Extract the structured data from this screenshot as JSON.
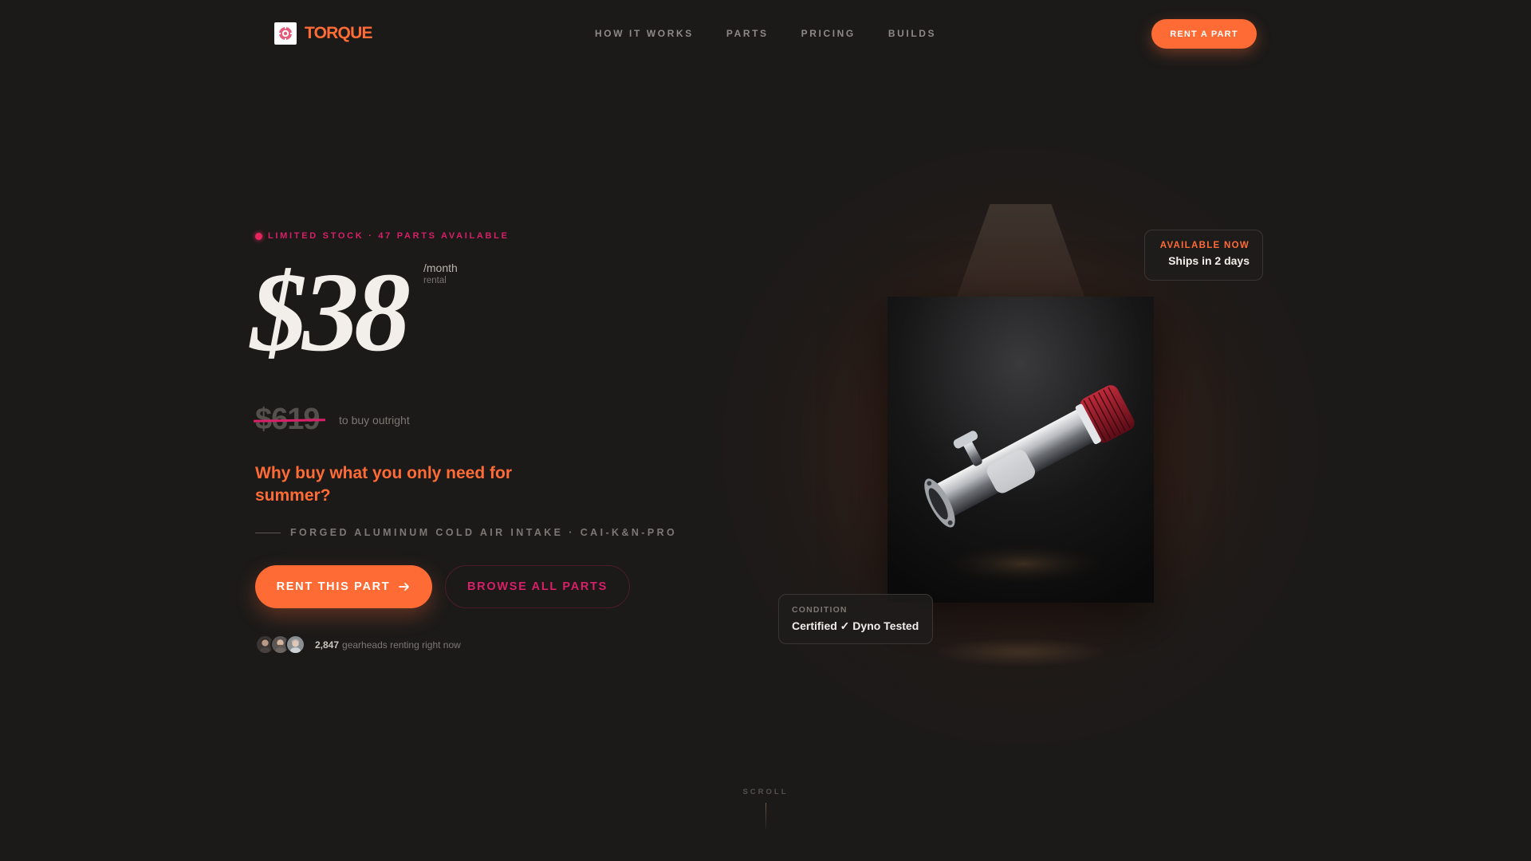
{
  "brand": {
    "name": "TORQUE",
    "logo_icon": "gear-cog-icon",
    "accent": "#ff6b35",
    "secondary": "#d81f67"
  },
  "nav": {
    "links": [
      "HOW IT WORKS",
      "PARTS",
      "PRICING",
      "BUILDS"
    ],
    "cta": "RENT A PART"
  },
  "hero": {
    "stock_label": "LIMITED STOCK · 47 PARTS AVAILABLE",
    "price": "$38",
    "price_period": "/month",
    "price_period_sub": "rental",
    "old_price": "$619",
    "old_price_note": "to buy outright",
    "tagline": "Why buy what you only need for summer?",
    "product_name": "FORGED ALUMINUM COLD AIR INTAKE · CAI-K&N-PRO",
    "primary_button": "RENT THIS PART",
    "secondary_button": "BROWSE ALL PARTS",
    "social_count": "2,847",
    "social_text": "gearheads renting right now"
  },
  "cards": {
    "availability": {
      "kicker": "AVAILABLE NOW",
      "value": "Ships in 2 days"
    },
    "condition": {
      "kicker": "CONDITION",
      "value": "Certified ✓ Dyno Tested"
    }
  },
  "scroll": {
    "label": "SCROLL"
  }
}
